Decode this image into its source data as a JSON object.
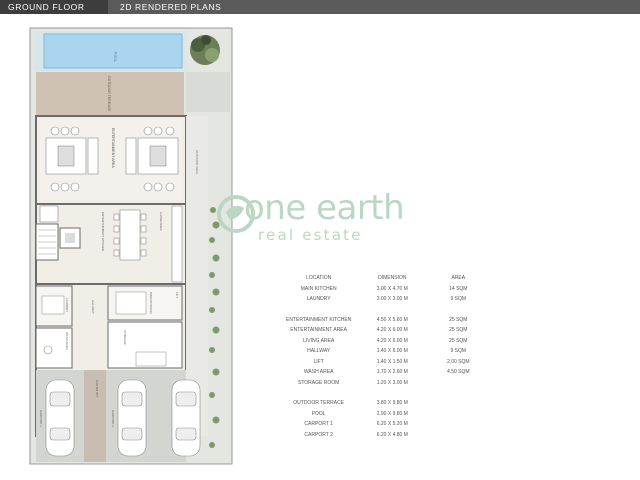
{
  "header": {
    "floor_label": "GROUND FLOOR",
    "plan_type_label": "2D RENDERED PLANS"
  },
  "plan_labels": {
    "pool": "POOL",
    "outdoor_terrace": "OUTDOOR TERRACE",
    "entertainment_area": "ENTERTAINMENT AREA",
    "outdoor_space": "OUTDOOR AREA",
    "kitchen": "ENTERTAINMENT KITCHEN",
    "living_area": "LIVING AREA",
    "storage": "STORAGE",
    "laundry": "LAUNDRY",
    "main_kitchen": "MAIN KITCHEN",
    "hallway": "HALLWAY",
    "wash_area": "WASH AREA",
    "lift": "LIFT",
    "carport_1": "CARPORT 1",
    "carport_2": "CARPORT 2",
    "car_entry": "CAR ENTRY"
  },
  "watermark": {
    "line1": "one earth",
    "line2": "real estate"
  },
  "area_table": {
    "headers": [
      "LOCATION",
      "DIMENSION",
      "AREA"
    ],
    "group1": [
      {
        "location": "MAIN KITCHEN",
        "dimension": "3.00 X 4.70 M",
        "area": "14 SQM"
      },
      {
        "location": "LAUNDRY",
        "dimension": "3.00 X 3.00 M",
        "area": "9 SQM"
      }
    ],
    "group2": [
      {
        "location": "ENTERTAINMENT KITCHEN",
        "dimension": "4.50 X 5.60 M",
        "area": "25 SQM"
      },
      {
        "location": "ENTERTAINMENT AREA",
        "dimension": "4.20 X 6.00 M",
        "area": "25 SQM"
      },
      {
        "location": "LIVING AREA",
        "dimension": "4.20 X 6.00 M",
        "area": "25 SQM"
      },
      {
        "location": "HALLWAY",
        "dimension": "1.40 X 6.00 M",
        "area": "9 SQM"
      },
      {
        "location": "LIFT",
        "dimension": "1.40 X 1.50 M",
        "area": "2.00 SQM"
      },
      {
        "location": "WASH AREA",
        "dimension": "1.70 X 2.60 M",
        "area": "4.50 SQM"
      },
      {
        "location": "STORAGE ROOM",
        "dimension": "1.20 X 3.00 M",
        "area": ""
      }
    ],
    "group3": [
      {
        "location": "OUTDOOR TERRACE",
        "dimension": "3.80 X 9.80 M",
        "area": ""
      },
      {
        "location": "POOL",
        "dimension": "2.90 X 9.80 M",
        "area": ""
      },
      {
        "location": "CARPORT 1",
        "dimension": "6.20 X 5.20 M",
        "area": ""
      },
      {
        "location": "CARPORT 2",
        "dimension": "6.20 X 4.80 M",
        "area": ""
      }
    ]
  },
  "colors": {
    "header_bg": "#5a5a5a",
    "header_tab": "#3d3d3d",
    "pool": "#a9d6ee",
    "terrace": "#cfc2b5",
    "stone": "#e4e6e2",
    "floor": "#f1ede7",
    "wall": "#6b6b6b",
    "watermark": "#b9d7c2"
  }
}
